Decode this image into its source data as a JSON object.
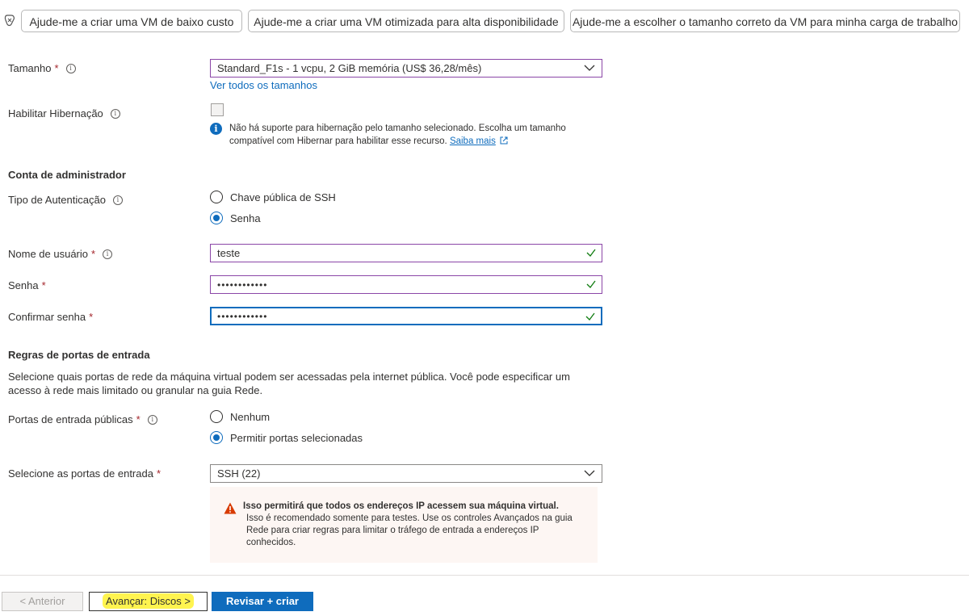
{
  "copilot": {
    "icon": "copilot-icon",
    "suggestions": [
      "Ajude-me a criar uma VM de baixo custo",
      "Ajude-me a criar uma VM otimizada para alta disponibilidade",
      "Ajude-me a escolher o tamanho correto da VM para minha carga de trabalho"
    ]
  },
  "size": {
    "label": "Tamanho",
    "required": "*",
    "value": "Standard_F1s - 1 vcpu, 2 GiB memória (US$ 36,28/mês)",
    "see_all_link": "Ver todos os tamanhos"
  },
  "hibernation": {
    "label": "Habilitar Hibernação",
    "checked": false,
    "note": "Não há suporte para hibernação pelo tamanho selecionado. Escolha um tamanho compatível com Hibernar para habilitar esse recurso.",
    "learn_more": "Saiba mais"
  },
  "admin": {
    "section_title": "Conta de administrador",
    "auth_type_label": "Tipo de Autenticação",
    "auth_options": [
      "Chave pública de SSH",
      "Senha"
    ],
    "auth_selected": "Senha",
    "username_label": "Nome de usuário",
    "username_value": "teste",
    "password_label": "Senha",
    "password_value": "••••••••••••",
    "confirm_label": "Confirmar senha",
    "confirm_value": "••••••••••••",
    "required": "*"
  },
  "ports": {
    "section_title": "Regras de portas de entrada",
    "description": "Selecione quais portas de rede da máquina virtual podem ser acessadas pela internet pública. Você pode especificar um acesso à rede mais limitado ou granular na guia Rede.",
    "public_label": "Portas de entrada públicas",
    "public_options": [
      "Nenhum",
      "Permitir portas selecionadas"
    ],
    "public_selected": "Permitir portas selecionadas",
    "select_label": "Selecione as portas de entrada",
    "select_value": "SSH (22)",
    "required": "*",
    "warning_title": "Isso permitirá que todos os endereços IP acessem sua máquina virtual.",
    "warning_body": "Isso é recomendado somente para testes.  Use os controles Avançados na guia Rede para criar regras para limitar o tráfego de entrada a endereços IP conhecidos."
  },
  "footer": {
    "prev_label": "< Anterior",
    "next_label": "Avançar: Discos >",
    "review_label": "Revisar + criar"
  },
  "colors": {
    "accent": "#0f6cbd",
    "required": "#a4262c",
    "highlight": "#fff44f",
    "valid": "#107c10",
    "warning": "#d83b01"
  }
}
